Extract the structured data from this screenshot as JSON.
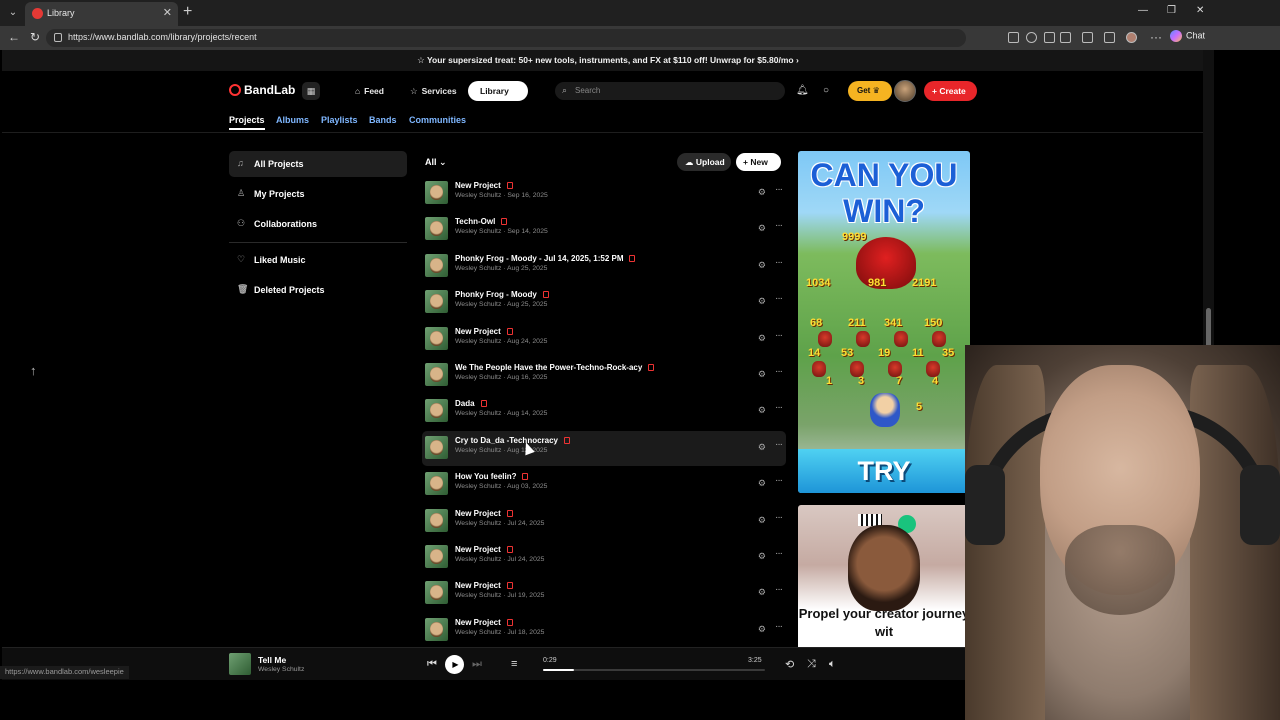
{
  "browser": {
    "tab_title": "Library",
    "url": "https://www.bandlab.com/library/projects/recent",
    "chat_label": "Chat"
  },
  "promo": {
    "text": "Your supersized treat: 50+ new tools, instruments, and FX at $110 off! Unwrap for $5.80/mo"
  },
  "header": {
    "logo": "BandLab",
    "nav": {
      "feed": "Feed",
      "services": "Services",
      "library": "Library"
    },
    "search_placeholder": "Search",
    "get_label": "Get",
    "create_label": "Create"
  },
  "subtabs": [
    "Projects",
    "Albums",
    "Playlists",
    "Bands",
    "Communities"
  ],
  "sidebar": [
    {
      "label": "All Projects",
      "icon": "music-note-icon"
    },
    {
      "label": "My Projects",
      "icon": "person-icon"
    },
    {
      "label": "Collaborations",
      "icon": "people-icon"
    },
    {
      "label": "Liked Music",
      "icon": "heart-icon"
    },
    {
      "label": "Deleted Projects",
      "icon": "trash-icon"
    }
  ],
  "list": {
    "filter": "All",
    "upload_label": "Upload",
    "new_label": "New",
    "rows": [
      {
        "title": "New Project",
        "author": "Wesley Schultz",
        "date": "Sep 16, 2025"
      },
      {
        "title": "Techn-Owl",
        "author": "Wesley Schultz",
        "date": "Sep 14, 2025"
      },
      {
        "title": "Phonky Frog - Moody - Jul 14, 2025, 1:52 PM",
        "author": "Wesley Schultz",
        "date": "Aug 25, 2025"
      },
      {
        "title": "Phonky Frog - Moody",
        "author": "Wesley Schultz",
        "date": "Aug 25, 2025"
      },
      {
        "title": "New Project",
        "author": "Wesley Schultz",
        "date": "Aug 24, 2025"
      },
      {
        "title": "We The People Have the Power-Techno-Rock-acy",
        "author": "Wesley Schultz",
        "date": "Aug 16, 2025"
      },
      {
        "title": "Dada",
        "author": "Wesley Schultz",
        "date": "Aug 14, 2025"
      },
      {
        "title": "Cry to Da_da -Technocracy",
        "author": "Wesley Schultz",
        "date": "Aug 12, 2025"
      },
      {
        "title": "How You feelin?",
        "author": "Wesley Schultz",
        "date": "Aug 03, 2025"
      },
      {
        "title": "New Project",
        "author": "Wesley Schultz",
        "date": "Jul 24, 2025"
      },
      {
        "title": "New Project",
        "author": "Wesley Schultz",
        "date": "Jul 24, 2025"
      },
      {
        "title": "New Project",
        "author": "Wesley Schultz",
        "date": "Jul 19, 2025"
      },
      {
        "title": "New Project",
        "author": "Wesley Schultz",
        "date": "Jul 18, 2025"
      }
    ]
  },
  "ads": {
    "ad1_headline": "CAN YOU WIN?",
    "ad1_cta": "TRY",
    "ad1_numbers": [
      "9999",
      "1034",
      "981",
      "2191",
      "68",
      "211",
      "341",
      "150",
      "14",
      "53",
      "19",
      "11",
      "35",
      "1",
      "3",
      "7",
      "4",
      "5"
    ],
    "ad2_text": "Propel your creator journey wit"
  },
  "player": {
    "title": "Tell Me",
    "artist": "Wesley Schultz",
    "elapsed": "0:29",
    "duration": "3:25",
    "progress": 0.14
  },
  "status_url": "https://www.bandlab.com/wesleepie"
}
